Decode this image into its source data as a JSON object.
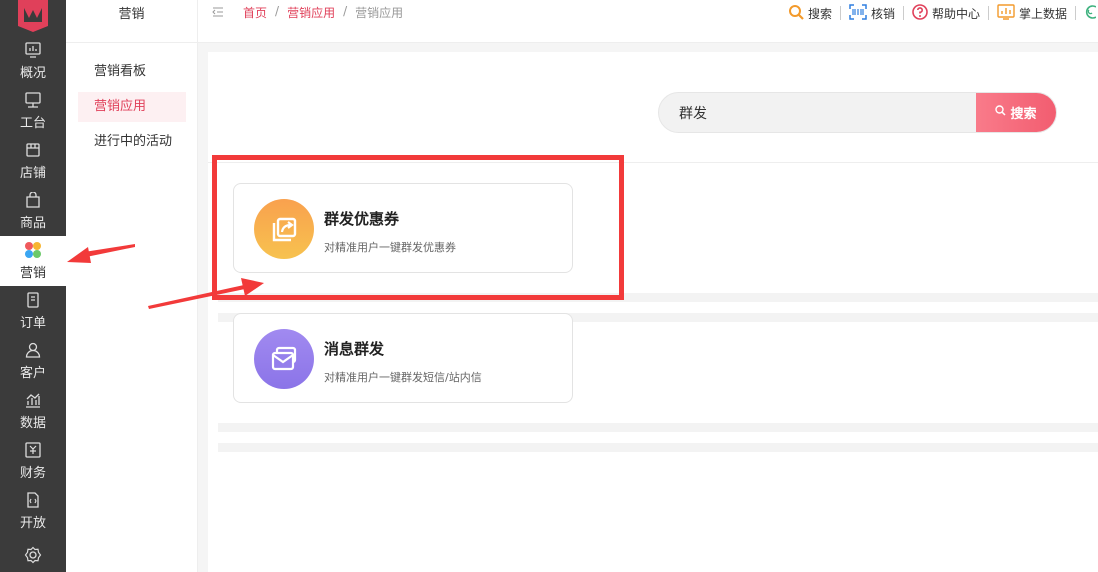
{
  "rail": {
    "items": [
      {
        "label": "概况",
        "icon": "overview-icon"
      },
      {
        "label": "工台",
        "icon": "desk-icon"
      },
      {
        "label": "店铺",
        "icon": "store-icon"
      },
      {
        "label": "商品",
        "icon": "goods-icon"
      },
      {
        "label": "营销",
        "icon": "marketing-icon"
      },
      {
        "label": "订单",
        "icon": "order-icon"
      },
      {
        "label": "客户",
        "icon": "customer-icon"
      },
      {
        "label": "数据",
        "icon": "data-icon"
      },
      {
        "label": "财务",
        "icon": "finance-icon"
      },
      {
        "label": "开放",
        "icon": "open-icon"
      }
    ]
  },
  "subnav": {
    "title": "营销",
    "items": [
      "营销看板",
      "营销应用",
      "进行中的活动"
    ]
  },
  "breadcrumb": {
    "items": [
      "首页",
      "营销应用",
      "营销应用"
    ],
    "separator": "/"
  },
  "tools": [
    {
      "label": "搜索",
      "icon": "search-icon"
    },
    {
      "label": "核销",
      "icon": "scan-icon"
    },
    {
      "label": "帮助中心",
      "icon": "help-icon"
    },
    {
      "label": "掌上数据",
      "icon": "mobile-data-icon"
    }
  ],
  "search": {
    "value": "群发",
    "button_label": "搜索"
  },
  "apps": [
    {
      "title": "群发优惠券",
      "desc": "对精准用户一键群发优惠券",
      "icon": "coupon-share-icon"
    },
    {
      "title": "消息群发",
      "desc": "对精准用户一键群发短信/站内信",
      "icon": "message-icon"
    }
  ],
  "colors": {
    "accent": "#e0405a",
    "rail_bg": "#3b3b3b",
    "highlight": "#f23a3a"
  }
}
